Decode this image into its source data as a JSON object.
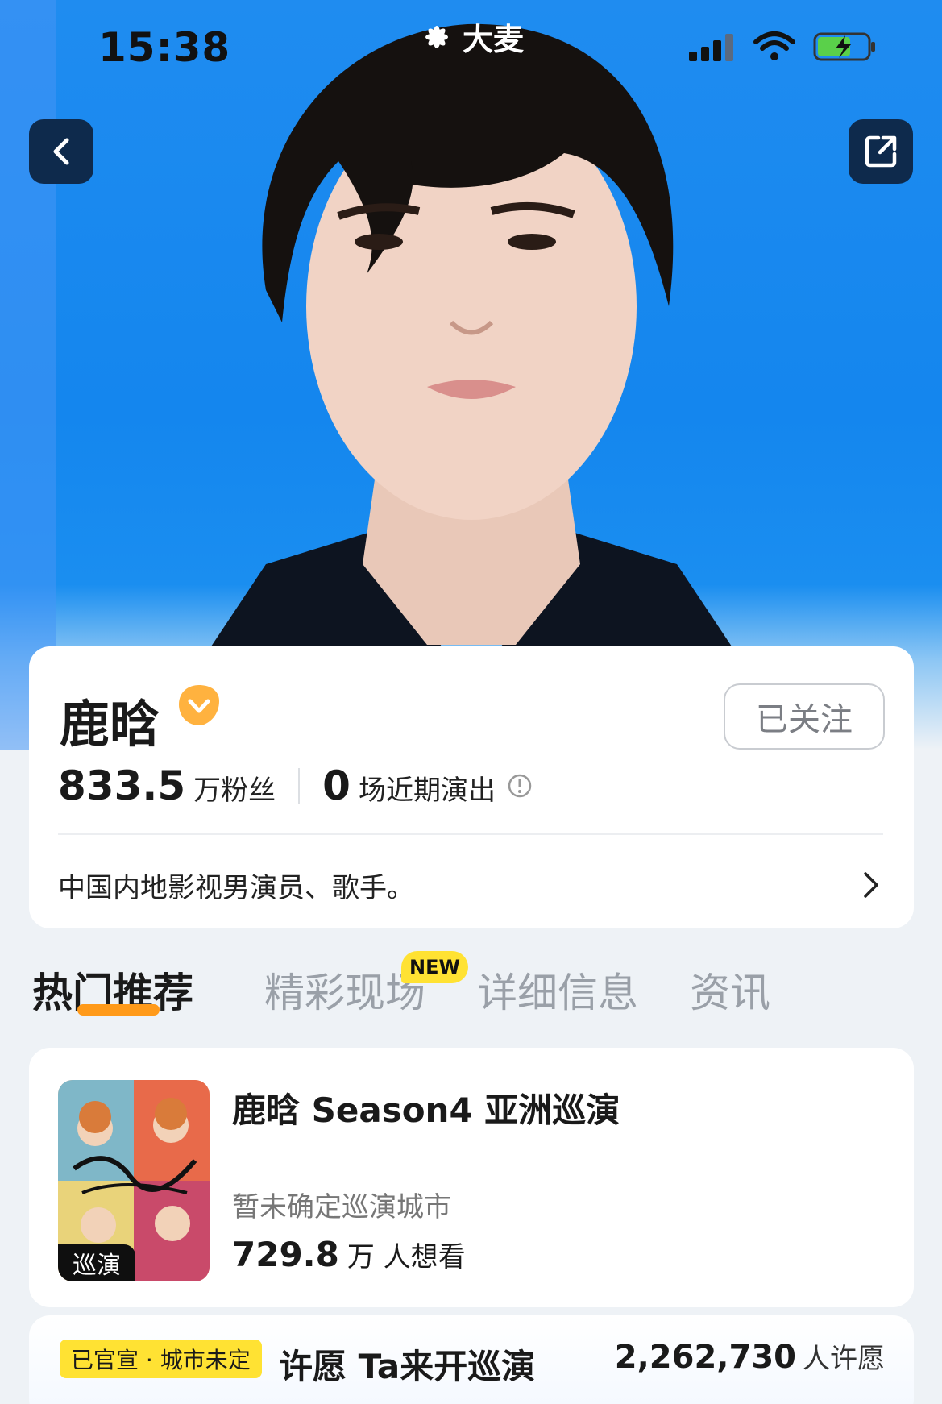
{
  "status_bar": {
    "time": "15:38",
    "app_brand": "大麦"
  },
  "artist": {
    "name": "鹿晗",
    "follow_label": "已关注",
    "fans_count": "833.5",
    "fans_label": "万粉丝",
    "shows_count": "0",
    "shows_label": "场近期演出",
    "bio": "中国内地影视男演员、歌手。"
  },
  "tabs": [
    {
      "label": "热门推荐",
      "active": true
    },
    {
      "label": "精彩现场",
      "badge": "NEW"
    },
    {
      "label": "详细信息"
    },
    {
      "label": "资讯"
    }
  ],
  "event": {
    "title": "鹿晗 Season4 亚洲巡演",
    "subtitle": "暂未确定巡演城市",
    "want_count": "729.8",
    "want_label": "万 人想看",
    "poster_tag": "巡演"
  },
  "wish": {
    "tag": "已官宣 · 城市未定",
    "title": "许愿 Ta来开巡演",
    "count": "2,262,730",
    "count_label": "人许愿"
  },
  "colors": {
    "accent": "#ff9a1a",
    "badge": "#ffe233",
    "hero_blue": "#1486ee"
  }
}
